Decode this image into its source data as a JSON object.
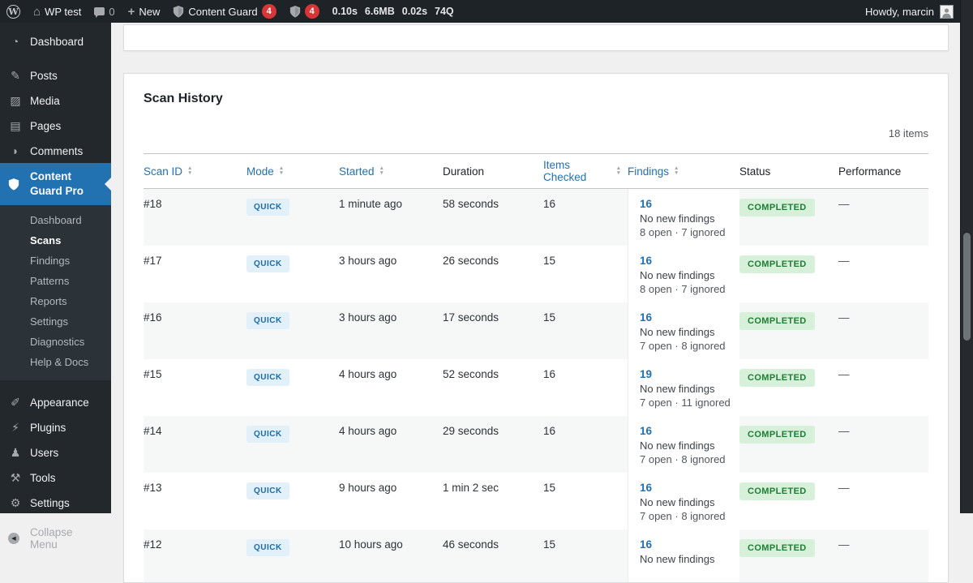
{
  "admin_bar": {
    "site_name": "WP test",
    "comments_count": "0",
    "new_label": "New",
    "plugin_label": "Content Guard",
    "plugin_badge": "4",
    "shield_badge": "4",
    "stats": [
      "0.10s",
      "6.6MB",
      "0.02s",
      "74Q"
    ],
    "howdy": "Howdy, marcin"
  },
  "sidebar": {
    "top_items": [
      {
        "label": "Dashboard",
        "icon": "dashboard-icon"
      },
      {
        "label": "Posts",
        "icon": "pushpin-icon"
      },
      {
        "label": "Media",
        "icon": "media-icon"
      },
      {
        "label": "Pages",
        "icon": "pages-icon"
      },
      {
        "label": "Comments",
        "icon": "comments-icon"
      }
    ],
    "active_item": {
      "label": "Content Guard Pro",
      "icon": "shield-icon"
    },
    "submenu": [
      {
        "label": "Dashboard",
        "current": false
      },
      {
        "label": "Scans",
        "current": true
      },
      {
        "label": "Findings",
        "current": false
      },
      {
        "label": "Patterns",
        "current": false
      },
      {
        "label": "Reports",
        "current": false
      },
      {
        "label": "Settings",
        "current": false
      },
      {
        "label": "Diagnostics",
        "current": false
      },
      {
        "label": "Help & Docs",
        "current": false
      }
    ],
    "bottom_items": [
      {
        "label": "Appearance",
        "icon": "paintbrush-icon"
      },
      {
        "label": "Plugins",
        "icon": "plugin-icon"
      },
      {
        "label": "Users",
        "icon": "user-icon"
      },
      {
        "label": "Tools",
        "icon": "wrench-icon"
      },
      {
        "label": "Settings",
        "icon": "gear-icon"
      }
    ],
    "collapse_label": "Collapse Menu"
  },
  "main": {
    "title": "Scan History",
    "items_count": "18 items",
    "table": {
      "columns": [
        {
          "label": "Scan ID",
          "sortable": true
        },
        {
          "label": "Mode",
          "sortable": true
        },
        {
          "label": "Started",
          "sortable": true
        },
        {
          "label": "Duration",
          "sortable": false
        },
        {
          "label": "Items Checked",
          "sortable": true
        },
        {
          "label": "Findings",
          "sortable": true
        },
        {
          "label": "Status",
          "sortable": false
        },
        {
          "label": "Performance",
          "sortable": false
        }
      ],
      "rows": [
        {
          "scan_id": "#18",
          "mode": "QUICK",
          "started": "1 minute ago",
          "duration": "58 seconds",
          "items_checked": "16",
          "findings_count": "16",
          "findings_line2": "No new findings",
          "findings_line3": "8 open · 7 ignored",
          "status": "COMPLETED",
          "performance": "—"
        },
        {
          "scan_id": "#17",
          "mode": "QUICK",
          "started": "3 hours ago",
          "duration": "26 seconds",
          "items_checked": "15",
          "findings_count": "16",
          "findings_line2": "No new findings",
          "findings_line3": "8 open · 7 ignored",
          "status": "COMPLETED",
          "performance": "—"
        },
        {
          "scan_id": "#16",
          "mode": "QUICK",
          "started": "3 hours ago",
          "duration": "17 seconds",
          "items_checked": "15",
          "findings_count": "16",
          "findings_line2": "No new findings",
          "findings_line3": "7 open · 8 ignored",
          "status": "COMPLETED",
          "performance": "—"
        },
        {
          "scan_id": "#15",
          "mode": "QUICK",
          "started": "4 hours ago",
          "duration": "52 seconds",
          "items_checked": "16",
          "findings_count": "19",
          "findings_line2": "No new findings",
          "findings_line3": "7 open · 11 ignored",
          "status": "COMPLETED",
          "performance": "—"
        },
        {
          "scan_id": "#14",
          "mode": "QUICK",
          "started": "4 hours ago",
          "duration": "29 seconds",
          "items_checked": "16",
          "findings_count": "16",
          "findings_line2": "No new findings",
          "findings_line3": "7 open · 8 ignored",
          "status": "COMPLETED",
          "performance": "—"
        },
        {
          "scan_id": "#13",
          "mode": "QUICK",
          "started": "9 hours ago",
          "duration": "1 min 2 sec",
          "items_checked": "15",
          "findings_count": "16",
          "findings_line2": "No new findings",
          "findings_line3": "7 open · 8 ignored",
          "status": "COMPLETED",
          "performance": "—"
        },
        {
          "scan_id": "#12",
          "mode": "QUICK",
          "started": "10 hours ago",
          "duration": "46 seconds",
          "items_checked": "15",
          "findings_count": "16",
          "findings_line2": "No new findings",
          "findings_line3": "",
          "status": "COMPLETED",
          "performance": "—"
        }
      ]
    }
  },
  "colors": {
    "accent_blue": "#2271b1",
    "badge_red": "#d63638",
    "mode_badge_bg": "#e2f0fa",
    "mode_badge_text": "#1a6ba6",
    "status_badge_bg": "#d7f0d9",
    "status_badge_text": "#1e7e34",
    "admin_bar_bg": "#1d2327",
    "sidebar_bg": "#23282d",
    "submenu_bg": "#2c3338",
    "content_bg": "#f0f0f1"
  }
}
